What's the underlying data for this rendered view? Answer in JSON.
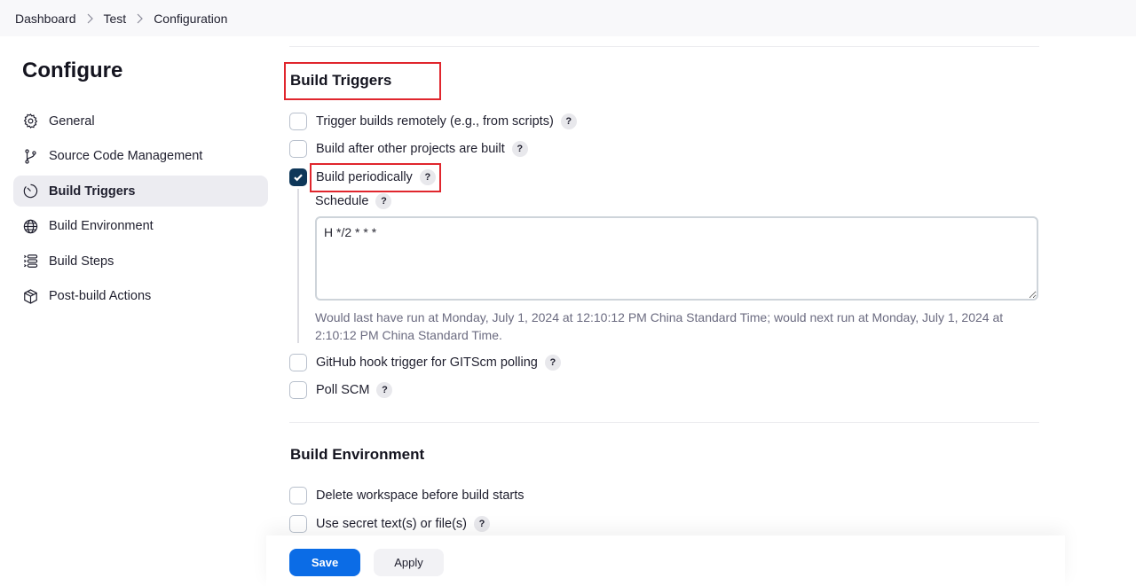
{
  "breadcrumb": [
    "Dashboard",
    "Test",
    "Configuration"
  ],
  "sidebar": {
    "title": "Configure",
    "items": [
      {
        "label": "General",
        "icon": "gear-icon",
        "active": false
      },
      {
        "label": "Source Code Management",
        "icon": "git-branch-icon",
        "active": false
      },
      {
        "label": "Build Triggers",
        "icon": "timer-icon",
        "active": true
      },
      {
        "label": "Build Environment",
        "icon": "globe-icon",
        "active": false
      },
      {
        "label": "Build Steps",
        "icon": "list-steps-icon",
        "active": false
      },
      {
        "label": "Post-build Actions",
        "icon": "package-icon",
        "active": false
      }
    ]
  },
  "build_triggers": {
    "title": "Build Triggers",
    "options": [
      {
        "label": "Trigger builds remotely (e.g., from scripts)",
        "checked": false,
        "help": "?"
      },
      {
        "label": "Build after other projects are built",
        "checked": false,
        "help": "?"
      },
      {
        "label": "Build periodically",
        "checked": true,
        "help": "?"
      },
      {
        "label": "GitHub hook trigger for GITScm polling",
        "checked": false,
        "help": "?"
      },
      {
        "label": "Poll SCM",
        "checked": false,
        "help": "?"
      }
    ],
    "schedule": {
      "label": "Schedule",
      "help": "?",
      "value": "H */2 * * *",
      "info": "Would last have run at Monday, July 1, 2024 at 12:10:12 PM China Standard Time; would next run at Monday, July 1, 2024 at 2:10:12 PM China Standard Time."
    }
  },
  "build_environment": {
    "title": "Build Environment",
    "options": [
      {
        "label": "Delete workspace before build starts",
        "checked": false
      },
      {
        "label": "Use secret text(s) or file(s)",
        "checked": false,
        "help": "?"
      }
    ]
  },
  "actions": {
    "save_label": "Save",
    "apply_label": "Apply"
  },
  "colors": {
    "accent": "#0b6ce6",
    "checked": "#0e3759",
    "highlight": "#e0262d"
  }
}
